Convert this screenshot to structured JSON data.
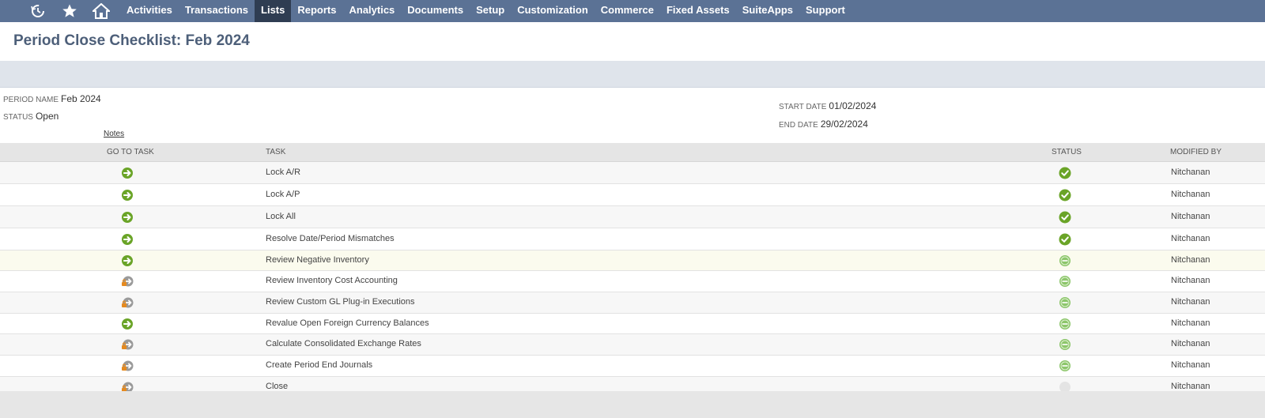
{
  "nav": {
    "icons": [
      "recent-icon",
      "star-icon",
      "home-icon"
    ],
    "items": [
      {
        "label": "Activities",
        "active": false
      },
      {
        "label": "Transactions",
        "active": false
      },
      {
        "label": "Lists",
        "active": true
      },
      {
        "label": "Reports",
        "active": false
      },
      {
        "label": "Analytics",
        "active": false
      },
      {
        "label": "Documents",
        "active": false
      },
      {
        "label": "Setup",
        "active": false
      },
      {
        "label": "Customization",
        "active": false
      },
      {
        "label": "Commerce",
        "active": false
      },
      {
        "label": "Fixed Assets",
        "active": false
      },
      {
        "label": "SuiteApps",
        "active": false
      },
      {
        "label": "Support",
        "active": false
      }
    ]
  },
  "page": {
    "title": "Period Close Checklist: Feb 2024"
  },
  "fields": {
    "period_name_label": "PERIOD NAME",
    "period_name_value": "Feb 2024",
    "status_label": "STATUS",
    "status_value": "Open",
    "notes_link": "Notes",
    "start_date_label": "START DATE",
    "start_date_value": "01/02/2024",
    "end_date_label": "END DATE",
    "end_date_value": "29/02/2024"
  },
  "table": {
    "headers": {
      "go_to_task": "GO TO TASK",
      "task": "TASK",
      "status": "STATUS",
      "modified_by": "MODIFIED BY"
    },
    "rows": [
      {
        "task": "Lock A/R",
        "go_icon": "arrow-go-icon",
        "status": "complete",
        "modified_by": "Nitchanan"
      },
      {
        "task": "Lock A/P",
        "go_icon": "arrow-go-icon",
        "status": "complete",
        "modified_by": "Nitchanan"
      },
      {
        "task": "Lock All",
        "go_icon": "arrow-go-icon",
        "status": "complete",
        "modified_by": "Nitchanan"
      },
      {
        "task": "Resolve Date/Period Mismatches",
        "go_icon": "arrow-go-icon",
        "status": "complete",
        "modified_by": "Nitchanan"
      },
      {
        "task": "Review Negative Inventory",
        "go_icon": "arrow-go-icon",
        "status": "pending",
        "modified_by": "Nitchanan"
      },
      {
        "task": "Review Inventory Cost Accounting",
        "go_icon": "locked-arrow-icon",
        "status": "pending",
        "modified_by": "Nitchanan"
      },
      {
        "task": "Review Custom GL Plug-in Executions",
        "go_icon": "locked-arrow-icon",
        "status": "pending",
        "modified_by": "Nitchanan"
      },
      {
        "task": "Revalue Open Foreign Currency Balances",
        "go_icon": "arrow-go-icon",
        "status": "pending",
        "modified_by": "Nitchanan"
      },
      {
        "task": "Calculate Consolidated Exchange Rates",
        "go_icon": "locked-arrow-icon",
        "status": "pending",
        "modified_by": "Nitchanan"
      },
      {
        "task": "Create Period End Journals",
        "go_icon": "locked-arrow-icon",
        "status": "pending",
        "modified_by": "Nitchanan"
      },
      {
        "task": "Close",
        "go_icon": "locked-arrow-icon",
        "status": "not-started",
        "modified_by": "Nitchanan"
      }
    ]
  },
  "colors": {
    "nav_bg": "#5b7295",
    "nav_active": "#2f3d52",
    "title": "#4d5f79",
    "green": "#6aa427",
    "pending_green": "#8cc66a",
    "lock_orange": "#e58a1f"
  }
}
